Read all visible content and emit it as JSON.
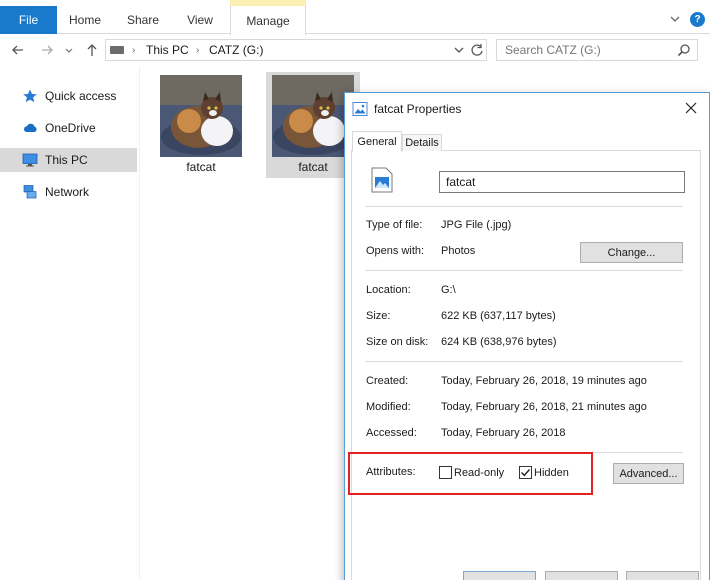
{
  "ribbon": {
    "tabs": [
      "File",
      "Home",
      "Share",
      "View",
      "Manage"
    ],
    "help_symbol": "?"
  },
  "address_bar": {
    "breadcrumb": [
      "This PC",
      "CATZ (G:)"
    ],
    "search_placeholder": "Search CATZ (G:)"
  },
  "sidebar": {
    "items": [
      {
        "label": "Quick access",
        "icon": "star-icon"
      },
      {
        "label": "OneDrive",
        "icon": "cloud-icon"
      },
      {
        "label": "This PC",
        "icon": "monitor-icon",
        "selected": true
      },
      {
        "label": "Network",
        "icon": "network-icon"
      }
    ]
  },
  "files": [
    {
      "name": "fatcat",
      "selected": false
    },
    {
      "name": "fatcat",
      "selected": true
    }
  ],
  "dialog": {
    "title": "fatcat Properties",
    "tabs": [
      "General",
      "Details"
    ],
    "file_name": "fatcat",
    "type_label": "Type of file:",
    "type_value": "JPG File (.jpg)",
    "opens_label": "Opens with:",
    "opens_value": "Photos",
    "change_button": "Change...",
    "location_label": "Location:",
    "location_value": "G:\\",
    "size_label": "Size:",
    "size_value": "622 KB (637,117 bytes)",
    "size_disk_label": "Size on disk:",
    "size_disk_value": "624 KB (638,976 bytes)",
    "created_label": "Created:",
    "created_value": "Today, February 26, 2018, 19 minutes ago",
    "modified_label": "Modified:",
    "modified_value": "Today, February 26, 2018, 21 minutes ago",
    "accessed_label": "Accessed:",
    "accessed_value": "Today, February 26, 2018",
    "attributes_label": "Attributes:",
    "readonly_label": "Read-only",
    "readonly_checked": false,
    "hidden_label": "Hidden",
    "hidden_checked": true,
    "advanced_button": "Advanced..."
  },
  "colors": {
    "accent": "#1979ca",
    "highlight_box": "#e32121",
    "selection": "#d9d9d9"
  }
}
